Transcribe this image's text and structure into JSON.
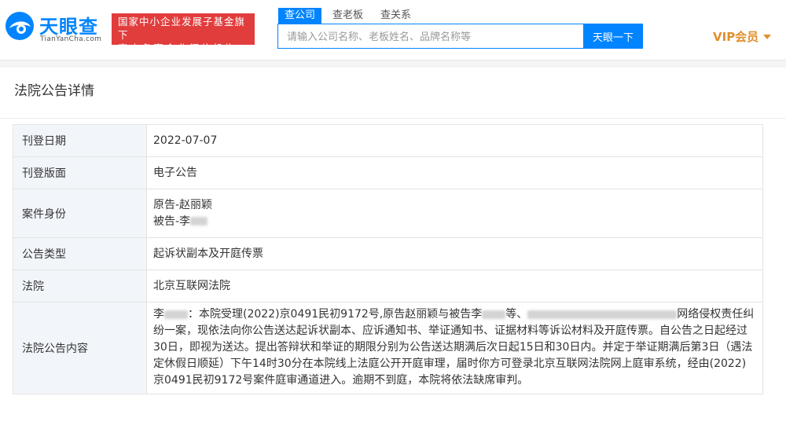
{
  "header": {
    "logo_text": "天眼查",
    "logo_sub": "TianYanCha.com",
    "slogan_line1": "国家中小企业发展子基金旗下",
    "slogan_line2": "官方备案企业征信机构",
    "search_tabs": [
      "查公司",
      "查老板",
      "查关系"
    ],
    "search_placeholder": "请输入公司名称、老板姓名、品牌名称等",
    "search_button": "天眼一下",
    "vip_label": "VIP会员",
    "brand_color": "#0084ff",
    "slogan_color": "#e23d3d",
    "vip_color": "#e0902e"
  },
  "card": {
    "title": "法院公告详情",
    "rows": [
      {
        "label": "刊登日期",
        "value": "2022-07-07"
      },
      {
        "label": "刊登版面",
        "value": "电子公告"
      },
      {
        "label": "案件身份",
        "plaintiff": "原告-赵丽颖",
        "defendant": "被告-李"
      },
      {
        "label": "公告类型",
        "value": "起诉状副本及开庭传票"
      },
      {
        "label": "法院",
        "value": "北京互联网法院"
      },
      {
        "label": "法院公告内容",
        "notice_p1": "李",
        "notice_p2": "：本院受理(2022)京0491民初9172号,原告赵丽颖与被告李",
        "notice_p3": "等、",
        "notice_p4": "网络侵权责任纠纷一案，现依法向你公告送达起诉状副本、应诉通知书、举证通知书、证据材料等诉讼材料及开庭传票。自公告之日起经过30日，即视为送达。提出答辩状和举证的期限分别为公告送达期满后次日起15日和30日内。并定于举证期满后第3日（遇法定休假日顺延）下午14时30分在本院线上法庭公开开庭审理，届时你方可登录北京互联网法院网上庭审系统，经由(2022)京0491民初9172号案件庭审通道进入。逾期不到庭，本院将依法缺席审判。"
      }
    ]
  }
}
